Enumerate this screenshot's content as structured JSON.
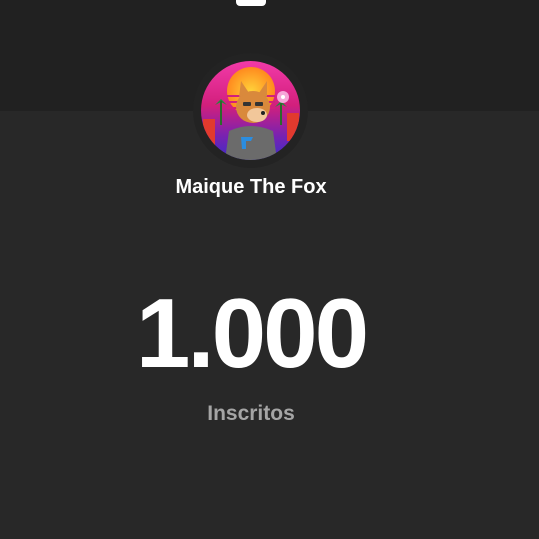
{
  "channel": {
    "name": "Maique The Fox",
    "avatar_icon": "fox-avatar-icon"
  },
  "stats": {
    "subscriber_count": "1.000",
    "subscriber_label": "Inscritos"
  },
  "colors": {
    "background": "#282828",
    "top_band": "#212121",
    "text_primary": "#ffffff",
    "text_secondary": "#a5a5a5"
  }
}
